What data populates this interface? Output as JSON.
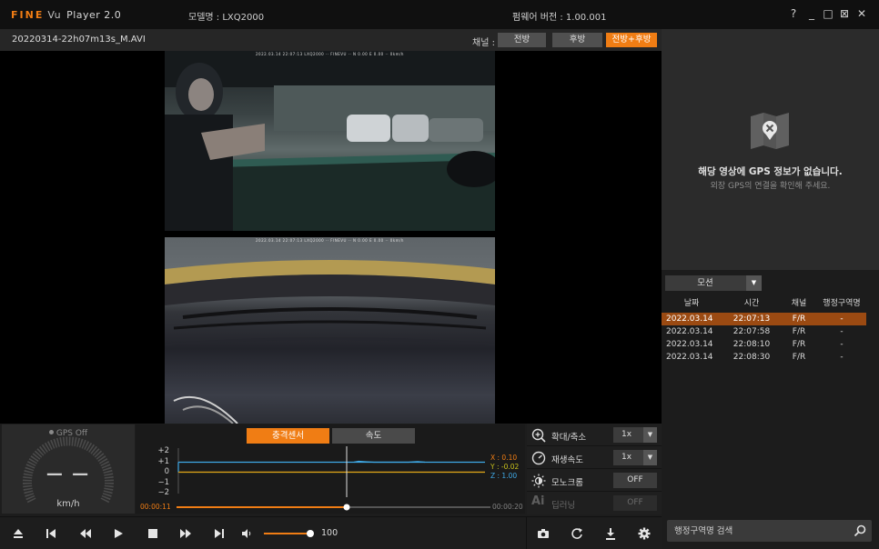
{
  "app": {
    "logo_brand": "FINE",
    "logo_vu": "Vu",
    "logo_player": "Player 2.0",
    "model": "모델명 : LXQ2000",
    "firmware": "펌웨어 버전 : 1.00.001",
    "window_controls": [
      "?",
      "_",
      "□",
      "⊠",
      "✕"
    ]
  },
  "file": {
    "name": "20220314-22h07m13s_M.AVI",
    "channel_label": "채널 :",
    "channels": [
      "전방",
      "후방",
      "전방+후방"
    ],
    "active_channel": "전방+후방"
  },
  "video": {
    "osd_text": "2022.03.14 22:07:13 LXQ2000 ·· FINEVU ·· N 0.00 E 0.00 ·· 0km/h"
  },
  "map": {
    "no_gps_title": "해당 영상에 GPS 정보가 없습니다.",
    "no_gps_sub": "외장 GPS의 연결을 확인해 주세요."
  },
  "events": {
    "filter": "모션",
    "headers": [
      "날짜",
      "시간",
      "채널",
      "행정구역명"
    ],
    "rows": [
      {
        "date": "2022.03.14",
        "time": "22:07:13",
        "channel": "F/R",
        "region": "-"
      },
      {
        "date": "2022.03.14",
        "time": "22:07:58",
        "channel": "F/R",
        "region": "-"
      },
      {
        "date": "2022.03.14",
        "time": "22:08:10",
        "channel": "F/R",
        "region": "-"
      },
      {
        "date": "2022.03.14",
        "time": "22:08:30",
        "channel": "F/R",
        "region": "-"
      }
    ],
    "selected_index": 0
  },
  "search": {
    "placeholder": "행정구역명 검색"
  },
  "speedometer": {
    "gps_status": "GPS Off",
    "value": "— —",
    "unit": "km/h"
  },
  "graph": {
    "tabs": [
      "충격센서",
      "속도"
    ],
    "active_tab": "충격센서",
    "y_ticks": [
      "+2",
      "+1",
      "0",
      "−1",
      "−2"
    ],
    "readout": {
      "x": "X :  0.10",
      "y": "Y : -0.02",
      "z": "Z :  1.00"
    },
    "time_start": "00:00:11",
    "time_end": "00:00:20",
    "playback_fraction": 0.55,
    "colors": {
      "x": "#f07d14",
      "y": "#c8c21c",
      "z": "#3fa9e6"
    }
  },
  "side_controls": {
    "zoom_label": "확대/축소",
    "zoom_value": "1x",
    "speed_label": "재생속도",
    "speed_value": "1x",
    "mono_label": "모노크롬",
    "mono_value": "OFF",
    "ai_label": "딥러닝",
    "ai_value": "OFF"
  },
  "playback": {
    "volume": "100",
    "volume_fraction": 1.0
  },
  "accent_color": "#f07d14"
}
